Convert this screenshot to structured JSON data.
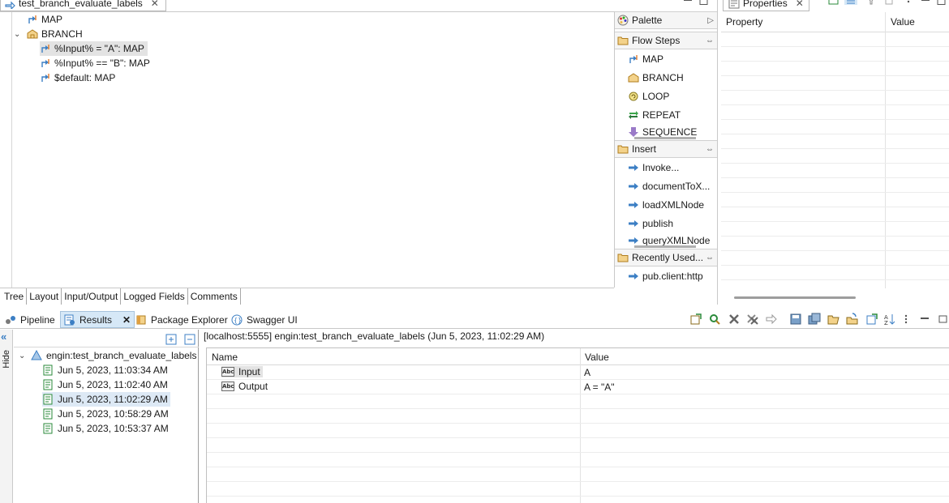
{
  "editor": {
    "tab_title": "test_branch_evaluate_labels",
    "tree": [
      {
        "label": "MAP"
      },
      {
        "label": "BRANCH"
      },
      {
        "label": "%Input% = \"A\": MAP"
      },
      {
        "label": "%Input% == \"B\": MAP"
      },
      {
        "label": "$default: MAP"
      }
    ],
    "bottom_tabs": [
      "Tree",
      "Layout",
      "Input/Output",
      "Logged Fields",
      "Comments"
    ]
  },
  "palette": {
    "title": "Palette",
    "flow_steps": {
      "title": "Flow Steps",
      "items": [
        "MAP",
        "BRANCH",
        "LOOP",
        "REPEAT",
        "SEQUENCE"
      ]
    },
    "insert": {
      "title": "Insert",
      "items": [
        "Invoke...",
        "documentToX...",
        "loadXMLNode",
        "publish",
        "queryXMLNode"
      ]
    },
    "recent": {
      "title": "Recently Used...",
      "items": [
        "pub.client:http"
      ]
    }
  },
  "properties": {
    "tab_title": "Properties",
    "col_property": "Property",
    "col_value": "Value"
  },
  "views": {
    "tabs": [
      "Pipeline",
      "Results",
      "Package Explorer",
      "Swagger UI"
    ],
    "active": "Results"
  },
  "results": {
    "hide_label": "Hide",
    "root": "engin:test_branch_evaluate_labels",
    "runs": [
      "Jun 5, 2023, 11:03:34 AM",
      "Jun 5, 2023, 11:02:40 AM",
      "Jun 5, 2023, 11:02:29 AM",
      "Jun 5, 2023, 10:58:29 AM",
      "Jun 5, 2023, 10:53:37 AM"
    ],
    "selected_index": 2,
    "detail_title": "[localhost:5555] engin:test_branch_evaluate_labels (Jun 5, 2023, 11:02:29 AM)",
    "col_name": "Name",
    "col_value": "Value",
    "rows": [
      {
        "name": "Input",
        "value": "A"
      },
      {
        "name": "Output",
        "value": "A = \"A\""
      }
    ]
  },
  "colors": {
    "accent": "#3c7fc4",
    "selection": "#dde9f5",
    "folder": "#e8b84a"
  }
}
